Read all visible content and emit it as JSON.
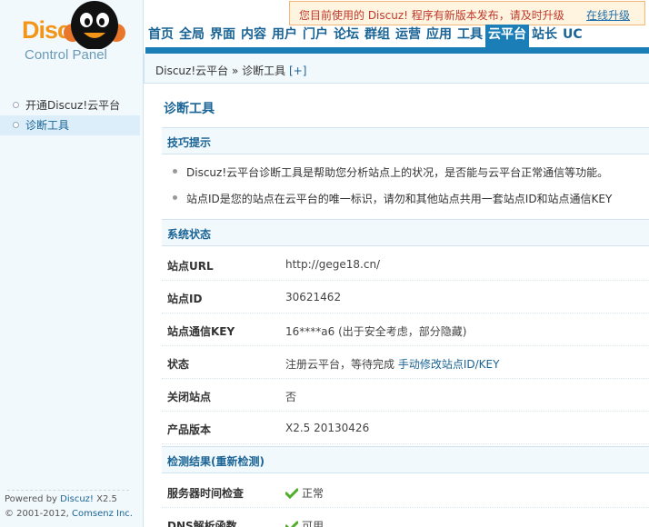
{
  "header": {
    "logo_text": "Discuz!",
    "logo_subtitle": "Control Panel",
    "notice": {
      "text": "您目前使用的 Discuz! 程序有新版本发布，请及时升级",
      "link": "在线升级"
    },
    "nav": [
      "首页",
      "全局",
      "界面",
      "内容",
      "用户",
      "门户",
      "论坛",
      "群组",
      "运营",
      "应用",
      "工具",
      "云平台",
      "站长",
      "UC"
    ],
    "nav_active": "云平台"
  },
  "breadcrumb": {
    "text": "Discuz!云平台 » 诊断工具",
    "add": "[+]"
  },
  "sidebar": {
    "items": [
      {
        "label": "开通Discuz!云平台"
      },
      {
        "label": "诊断工具"
      }
    ],
    "footer": {
      "powered_prefix": "Powered by ",
      "powered_name": "Discuz!",
      "version": " X2.5",
      "copyright_prefix": "© 2001-2012, ",
      "company": "Comsenz Inc."
    }
  },
  "main": {
    "title": "诊断工具",
    "tips_title": "技巧提示",
    "tips": [
      "Discuz!云平台诊断工具是帮助您分析站点上的状况，是否能与云平台正常通信等功能。",
      "站点ID是您的站点在云平台的唯一标识，请勿和其他站点共用一套站点ID和站点通信KEY"
    ],
    "status_title": "系统状态",
    "status_rows": [
      {
        "label": "站点URL",
        "value": "http://gege18.cn/"
      },
      {
        "label": "站点ID",
        "value": "30621462"
      },
      {
        "label": "站点通信KEY",
        "value": "16****a6 (出于安全考虑，部分隐藏)"
      },
      {
        "label": "状态",
        "value": "注册云平台，等待完成",
        "link": "手动修改站点ID/KEY"
      },
      {
        "label": "关闭站点",
        "value": "否"
      },
      {
        "label": "产品版本",
        "value": "X2.5 20130426"
      }
    ],
    "result_title": "检测结果(重新检测)",
    "result_rows": [
      {
        "label": "服务器时间检查",
        "value": "正常"
      },
      {
        "label": "DNS解析函数",
        "value": "可用"
      }
    ]
  },
  "colors": {
    "accent": "#1c7eb7",
    "brand_orange": "#f29518",
    "notice_red": "#c0392b",
    "check_green": "#4caf27"
  }
}
